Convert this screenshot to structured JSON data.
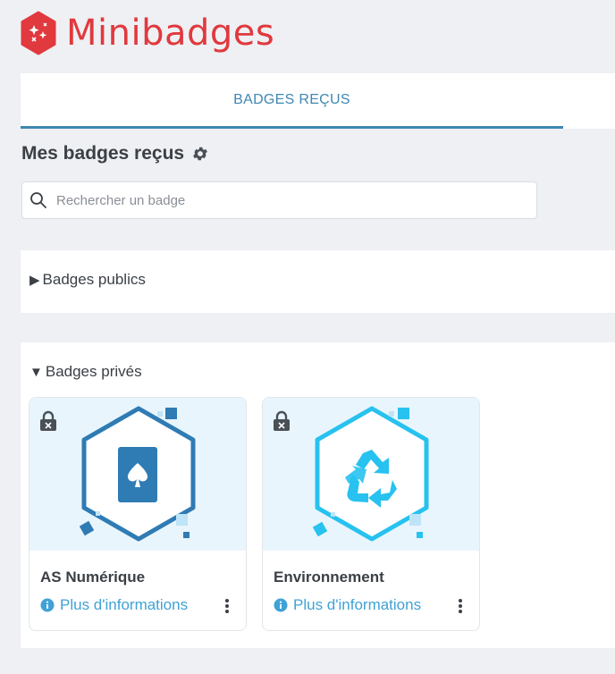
{
  "app": {
    "name": "Minibadges",
    "brand_color": "#e0393e",
    "accent_color": "#3f87b2"
  },
  "tabs": [
    {
      "label": "BADGES REÇUS",
      "active": true
    }
  ],
  "page": {
    "title": "Mes badges reçus",
    "settings_icon": "gear-icon"
  },
  "search": {
    "placeholder": "Rechercher un badge",
    "value": ""
  },
  "sections": {
    "public": {
      "label": "Badges publics",
      "expanded": false
    },
    "private": {
      "label": "Badges privés",
      "expanded": true
    }
  },
  "badges": [
    {
      "name": "AS Numérique",
      "link_label": "Plus d'informations",
      "icon": "spade-card-icon",
      "color": "#2f7bb4",
      "locked": true
    },
    {
      "name": "Environnement",
      "link_label": "Plus d'informations",
      "icon": "recycle-icon",
      "color": "#27c2ef",
      "locked": true
    }
  ]
}
